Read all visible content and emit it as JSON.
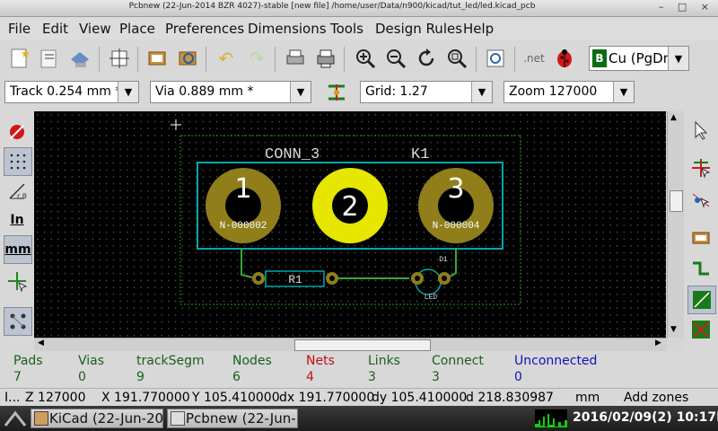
{
  "window": {
    "title": "Pcbnew (22-Jun-2014 BZR 4027)-stable  [new file] /home/user/Data/n900/kicad/tut_led/led.kicad_pcb",
    "controls": "– □ ×"
  },
  "menu": [
    "File",
    "Edit",
    "View",
    "Place",
    "Preferences",
    "Dimensions",
    "Tools",
    "Design Rules",
    "Help"
  ],
  "toolbar": {
    "net_label": ".net",
    "layer_select": "Cu (PgDn)",
    "layer_badge": "B"
  },
  "aux_toolbar": {
    "track": "Track 0.254 mm *",
    "via": "Via 0.889 mm *",
    "grid": "Grid: 1.27",
    "zoom": "Zoom 127000"
  },
  "left_toolbar": {
    "inch_label": "In",
    "mm_label": "mm"
  },
  "board": {
    "module_ref": "CONN_3",
    "module_value": "K1",
    "pads": [
      {
        "number": "1",
        "net": "N-000002"
      },
      {
        "number": "2",
        "net": ""
      },
      {
        "number": "3",
        "net": "N-000004"
      }
    ],
    "resistor": "R1",
    "led_ref": "D1",
    "led_value": "LED"
  },
  "status": [
    {
      "label": "Pads",
      "value": "7",
      "color": "#1a5e1a"
    },
    {
      "label": "Vias",
      "value": "0",
      "color": "#1a5e1a"
    },
    {
      "label": "trackSegm",
      "value": "9",
      "color": "#1a5e1a"
    },
    {
      "label": "Nodes",
      "value": "6",
      "color": "#1a5e1a"
    },
    {
      "label": "Nets",
      "value": "4",
      "color": "#c01010"
    },
    {
      "label": "Links",
      "value": "3",
      "color": "#1a5e1a"
    },
    {
      "label": "Connect",
      "value": "3",
      "color": "#1a5e1a"
    },
    {
      "label": "Unconnected",
      "value": "0",
      "color": "#1010c0"
    }
  ],
  "coords": {
    "lead": "I...",
    "z": "Z 127000",
    "x": "X 191.770000",
    "y": "Y 105.410000",
    "dx": "dx 191.770000",
    "dy": "dy 105.410000",
    "d": "d 218.830987",
    "units": "mm",
    "mode": "Add zones"
  },
  "taskbar": {
    "tasks": [
      "KiCad (22-Jun-20...",
      "Pcbnew (22-Jun-..."
    ],
    "clock": "2016/02/09(2) 10:17PM"
  },
  "colors": {
    "pad": "#c8b400",
    "pad_hole": "#ffffff",
    "outline": "#00aaaa",
    "track": "#3aa83a",
    "edge": "#1e9e1e"
  }
}
